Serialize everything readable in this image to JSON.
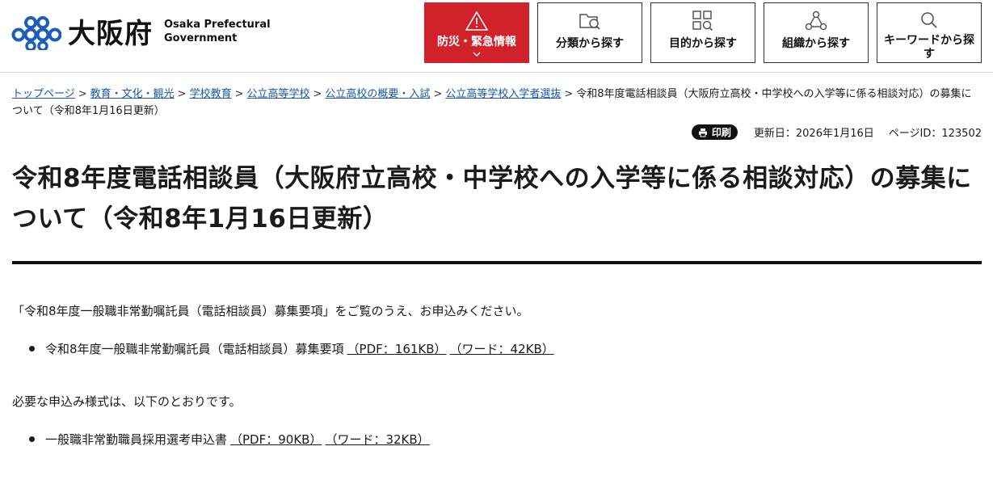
{
  "header": {
    "logo_jp": "大阪府",
    "logo_en_line1": "Osaka Prefectural",
    "logo_en_line2": "Government",
    "nav": [
      {
        "label": "防災・緊急情報",
        "icon": "warning-icon"
      },
      {
        "label": "分類から探す",
        "icon": "folder-search-icon"
      },
      {
        "label": "目的から探す",
        "icon": "grid-search-icon"
      },
      {
        "label": "組織から探す",
        "icon": "org-tree-icon"
      },
      {
        "label": "キーワードから探す",
        "icon": "search-icon"
      }
    ],
    "colors": {
      "disaster": "#d1212b",
      "logo": "#1d5fb8"
    }
  },
  "breadcrumb": {
    "items": [
      "トップページ",
      "教育・文化・観光",
      "学校教育",
      "公立高等学校",
      "公立高校の概要・入試",
      "公立高等学校入学者選抜"
    ],
    "current": "令和8年度電話相談員（大阪府立高校・中学校への入学等に係る相談対応）の募集について（令和8年1月16日更新）",
    "separator": ">"
  },
  "meta": {
    "print_label": "印刷",
    "updated": "更新日：2026年1月16日",
    "page_id": "ページID：123502"
  },
  "page_title": "令和8年度電話相談員（大阪府立高校・中学校への入学等に係る相談対応）の募集について（令和8年1月16日更新）",
  "content": {
    "intro": "「令和8年度一般職非常勤嘱託員（電話相談員）募集要項」をご覧のうえ、お申込みください。",
    "doc1": {
      "text": "令和8年度一般職非常勤嘱託員（電話相談員）募集要項",
      "pdf": "（PDF：161KB）",
      "word": "（ワード：42KB）"
    },
    "forms_intro": "必要な申込み様式は、以下のとおりです。",
    "doc2": {
      "text": "一般職非常勤職員採用選考申込書",
      "pdf": "（PDF：90KB）",
      "word": "（ワード：32KB）"
    }
  }
}
